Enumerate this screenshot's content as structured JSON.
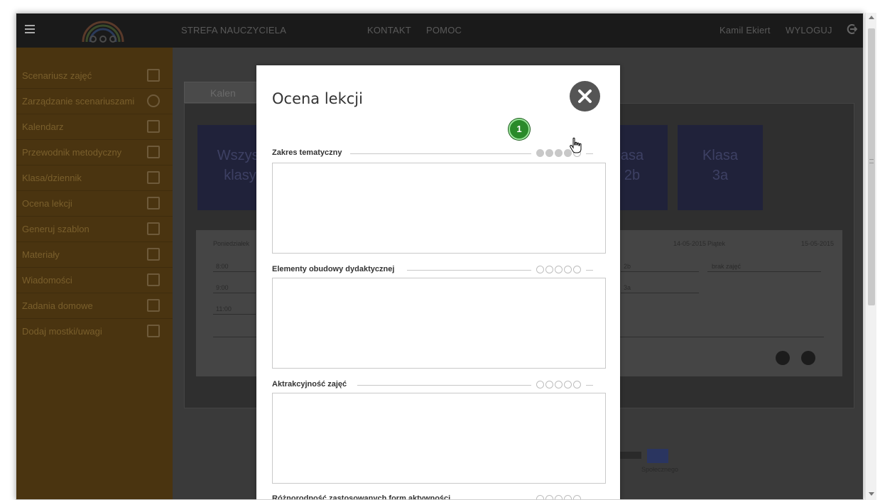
{
  "topbar": {
    "nav_teacher_zone": "STREFA NAUCZYCIELA",
    "nav_contact": "KONTAKT",
    "nav_help": "POMOC",
    "user_name": "Kamil Ekiert",
    "logout_label": "WYLOGUJ"
  },
  "sidebar": {
    "items": [
      {
        "label": "Scenariusz zajęć",
        "icon": "edit-icon"
      },
      {
        "label": "Zarządzanie scenariuszami",
        "icon": "check-circle-icon"
      },
      {
        "label": "Kalendarz",
        "icon": "calendar-icon"
      },
      {
        "label": "Przewodnik metodyczny",
        "icon": "book-icon"
      },
      {
        "label": "Klasa/dziennik",
        "icon": "journal-icon"
      },
      {
        "label": "Ocena lekcji",
        "icon": "chart-icon"
      },
      {
        "label": "Generuj szablon",
        "icon": "template-icon"
      },
      {
        "label": "Materiały",
        "icon": "film-icon"
      },
      {
        "label": "Wiadomości",
        "icon": "mail-icon"
      },
      {
        "label": "Zadania domowe",
        "icon": "homework-icon"
      },
      {
        "label": "Dodaj mostki/uwagi",
        "icon": "note-icon"
      }
    ]
  },
  "background": {
    "tab_label": "Kalen",
    "card_all_line1": "Wszyst",
    "card_all_line2": "klasy",
    "card_2b_line1": "asa",
    "card_2b_line2": "2b",
    "card_3a_line1": "Klasa",
    "card_3a_line2": "3a",
    "sched_monday": "Poniedziałek",
    "sched_date_thu": "14-05-2015",
    "sched_friday": "Piątek",
    "sched_date_fri": "15-05-2015",
    "time_1": "8:00",
    "time_2": "9:00",
    "time_3": "11:00",
    "class_2b": "2b",
    "class_3a": "3a",
    "no_classes": "brak zajęć",
    "footer_text": "Społecznego"
  },
  "modal": {
    "title": "Ocena lekcji",
    "sections": [
      {
        "label": "Zakres tematyczny",
        "rating": 4,
        "max": 5,
        "value": ""
      },
      {
        "label": "Elementy obudowy dydaktycznej",
        "rating": 0,
        "max": 5,
        "value": ""
      },
      {
        "label": "Aktrakcyjność zajęć",
        "rating": 0,
        "max": 5,
        "value": ""
      },
      {
        "label": "Różnorodność zastosowanych form aktywności",
        "rating": 0,
        "max": 5,
        "value": ""
      }
    ]
  },
  "annotation": {
    "step_number": "1"
  },
  "colors": {
    "topbar": "#1a1a1a",
    "sidebar": "#4a3410",
    "overlay_main": "#3a3a3a",
    "step_badge": "#2a8a2a",
    "rating_filled": "#c8c8c8"
  }
}
